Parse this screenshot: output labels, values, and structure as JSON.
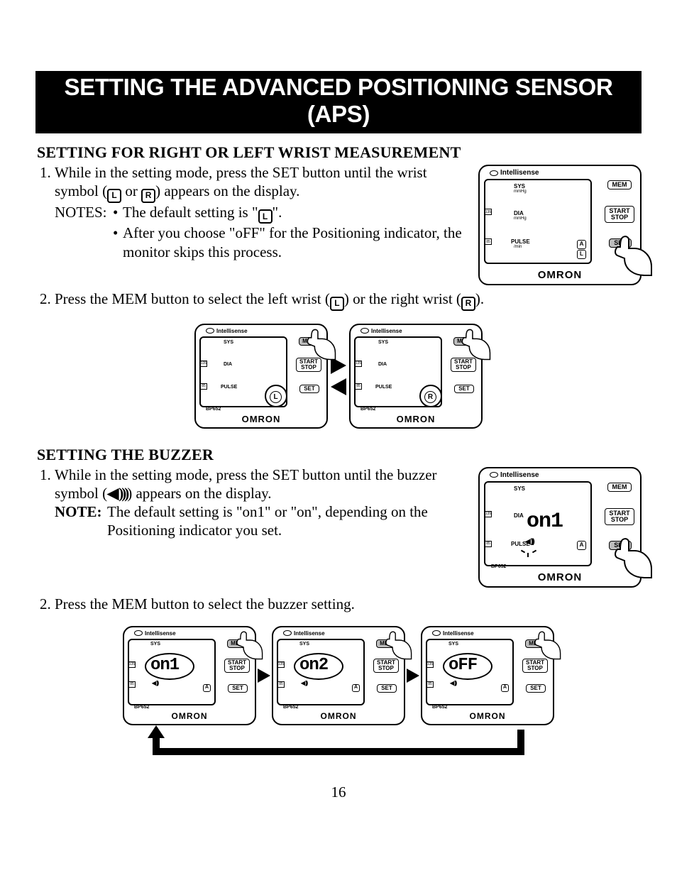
{
  "page_number": "16",
  "title": "SETTING THE ADVANCED POSITIONING SENSOR (APS)",
  "section_wrist": {
    "heading": "SETTING FOR RIGHT OR LEFT WRIST MEASUREMENT",
    "step1_a": "While in the setting mode, press the SET button until the wrist symbol (",
    "step1_b": " or ",
    "step1_c": ") appears on the display.",
    "notes_label": "NOTES:",
    "note1_a": "The default setting is \"",
    "note1_b": "\".",
    "note2": "After you choose \"oFF\" for the Positioning indicator, the monitor skips this process.",
    "step2_a": "Press the MEM button to select the left wrist (",
    "step2_b": ") or the right wrist (",
    "step2_c": ")."
  },
  "section_buzzer": {
    "heading": "SETTING THE BUZZER",
    "step1_a": "While in the setting mode, press the SET button until the buzzer symbol (",
    "step1_b": ") appears on the display.",
    "note_label": "NOTE:",
    "note_text": "The default setting is \"on1\" or \"on\", depending on the Positioning indicator you set.",
    "step2": "Press the MEM button to select the buzzer setting."
  },
  "device": {
    "intellisense": "Intellisense",
    "sys": "SYS",
    "sys_unit": "mmHg",
    "dia": "DIA",
    "dia_unit": "mmHg",
    "pulse": "PULSE",
    "pulse_unit": "/min",
    "tick135": "135",
    "tick85": "85",
    "btn_mem": "MEM",
    "btn_start": "START",
    "btn_stop": "STOP",
    "btn_set": "SET",
    "brand": "OMRON",
    "model": "BP652",
    "letter_A": "A",
    "letter_L": "L",
    "letter_R": "R"
  },
  "buzzer_values": {
    "on1": "on1",
    "on2": "on2",
    "off": "oFF"
  },
  "icons": {
    "L": "L",
    "R": "R",
    "speaker": "◀",
    "waves": ")))"
  }
}
